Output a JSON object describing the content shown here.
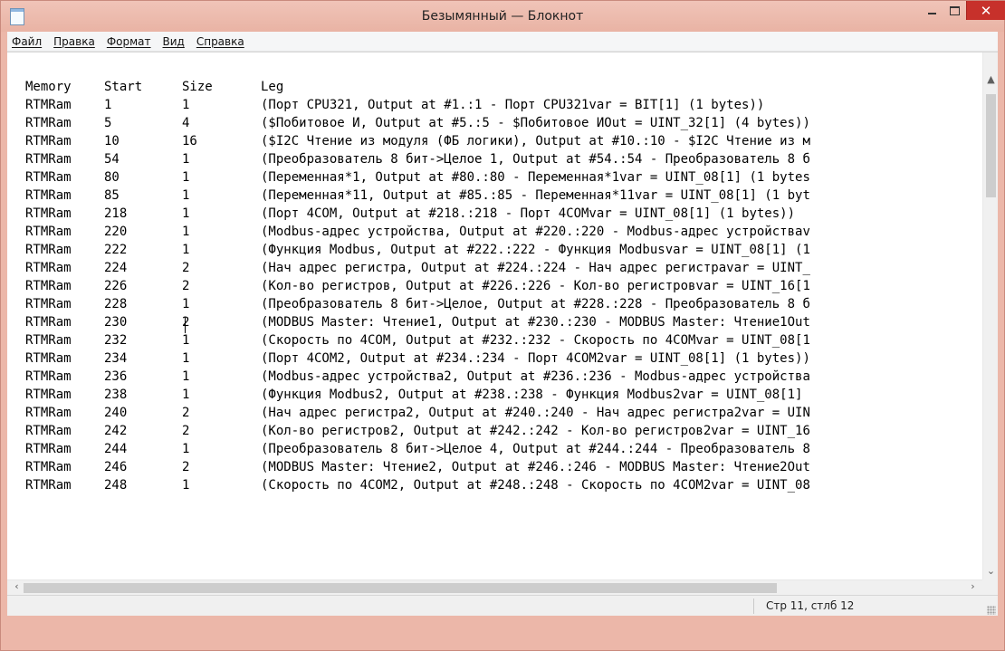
{
  "window": {
    "title": "Безымянный — Блокнот"
  },
  "menu": [
    "Файл",
    "Правка",
    "Формат",
    "Вид",
    "Справка"
  ],
  "table": {
    "headers": [
      "Memory",
      "Start",
      "Size",
      "Leg"
    ],
    "rows": [
      [
        "RTMRam",
        "1",
        "1",
        "(Порт CPU321, Output at #1.:1 - Порт CPU321var = BIT[1] (1 bytes))"
      ],
      [
        "RTMRam",
        "5",
        "4",
        "($Побитовое И, Output at #5.:5 - $Побитовое ИOut = UINT_32[1] (4 bytes))"
      ],
      [
        "RTMRam",
        "10",
        "16",
        "($I2C Чтение из модуля (ФБ логики), Output at #10.:10 - $I2C Чтение из м"
      ],
      [
        "RTMRam",
        "54",
        "1",
        "(Преобразователь 8 бит->Целое 1, Output at #54.:54 - Преобразователь 8 б"
      ],
      [
        "RTMRam",
        "80",
        "1",
        "(Переменная*1, Output at #80.:80 - Переменная*1var = UINT_08[1] (1 bytes"
      ],
      [
        "RTMRam",
        "85",
        "1",
        "(Переменная*11, Output at #85.:85 - Переменная*11var = UINT_08[1] (1 byt"
      ],
      [
        "RTMRam",
        "218",
        "1",
        "(Порт 4COM, Output at #218.:218 - Порт 4COMvar = UINT_08[1] (1 bytes))"
      ],
      [
        "RTMRam",
        "220",
        "1",
        "(Modbus-адрес устройства, Output at #220.:220 - Modbus-адрес устройстваv"
      ],
      [
        "RTMRam",
        "222",
        "1",
        "(Функция Modbus, Output at #222.:222 - Функция Modbusvar = UINT_08[1] (1"
      ],
      [
        "RTMRam",
        "224",
        "2",
        "(Нач адрес регистра, Output at #224.:224 - Нач адрес регистраvar = UINT_"
      ],
      [
        "RTMRam",
        "226",
        "2",
        "(Кол-во регистров, Output at #226.:226 - Кол-во регистровvar = UINT_16[1"
      ],
      [
        "RTMRam",
        "228",
        "1",
        "(Преобразователь 8 бит->Целое, Output at #228.:228 - Преобразователь 8 б"
      ],
      [
        "RTMRam",
        "230",
        "2",
        "(MODBUS Master: Чтение1, Output at #230.:230 - MODBUS Master: Чтение1Out"
      ],
      [
        "RTMRam",
        "232",
        "1",
        "(Скорость по 4COM, Output at #232.:232 - Скорость по 4COMvar = UINT_08[1"
      ],
      [
        "RTMRam",
        "234",
        "1",
        "(Порт 4COM2, Output at #234.:234 - Порт 4COM2var = UINT_08[1] (1 bytes))"
      ],
      [
        "RTMRam",
        "236",
        "1",
        "(Modbus-адрес устройства2, Output at #236.:236 - Modbus-адрес устройства"
      ],
      [
        "RTMRam",
        "238",
        "1",
        "(Функция Modbus2, Output at #238.:238 - Функция Modbus2var = UINT_08[1]"
      ],
      [
        "RTMRam",
        "240",
        "2",
        "(Нач адрес регистра2, Output at #240.:240 - Нач адрес регистра2var = UIN"
      ],
      [
        "RTMRam",
        "242",
        "2",
        "(Кол-во регистров2, Output at #242.:242 - Кол-во регистров2var = UINT_16"
      ],
      [
        "RTMRam",
        "244",
        "1",
        "(Преобразователь 8 бит->Целое 4, Output at #244.:244 - Преобразователь 8"
      ],
      [
        "RTMRam",
        "246",
        "2",
        "(MODBUS Master: Чтение2, Output at #246.:246 - MODBUS Master: Чтение2Out"
      ],
      [
        "RTMRam",
        "248",
        "1",
        "(Скорость по 4COM2, Output at #248.:248 - Скорость по 4COM2var = UINT_08"
      ]
    ]
  },
  "status": {
    "position": "Стр 11, стлб 12"
  },
  "colors": {
    "titlebar": "#ecb7a9",
    "close_button": "#c7312b",
    "editor_bg": "#ffffff"
  },
  "icons": {
    "app": "notepad-icon",
    "minimize": "minimize-icon",
    "maximize": "maximize-icon",
    "close": "close-icon",
    "scroll_up": "scroll-up-arrow-icon",
    "scroll_down": "scroll-down-arrow-icon",
    "scroll_left": "scroll-left-arrow-icon",
    "scroll_right": "scroll-right-arrow-icon"
  }
}
